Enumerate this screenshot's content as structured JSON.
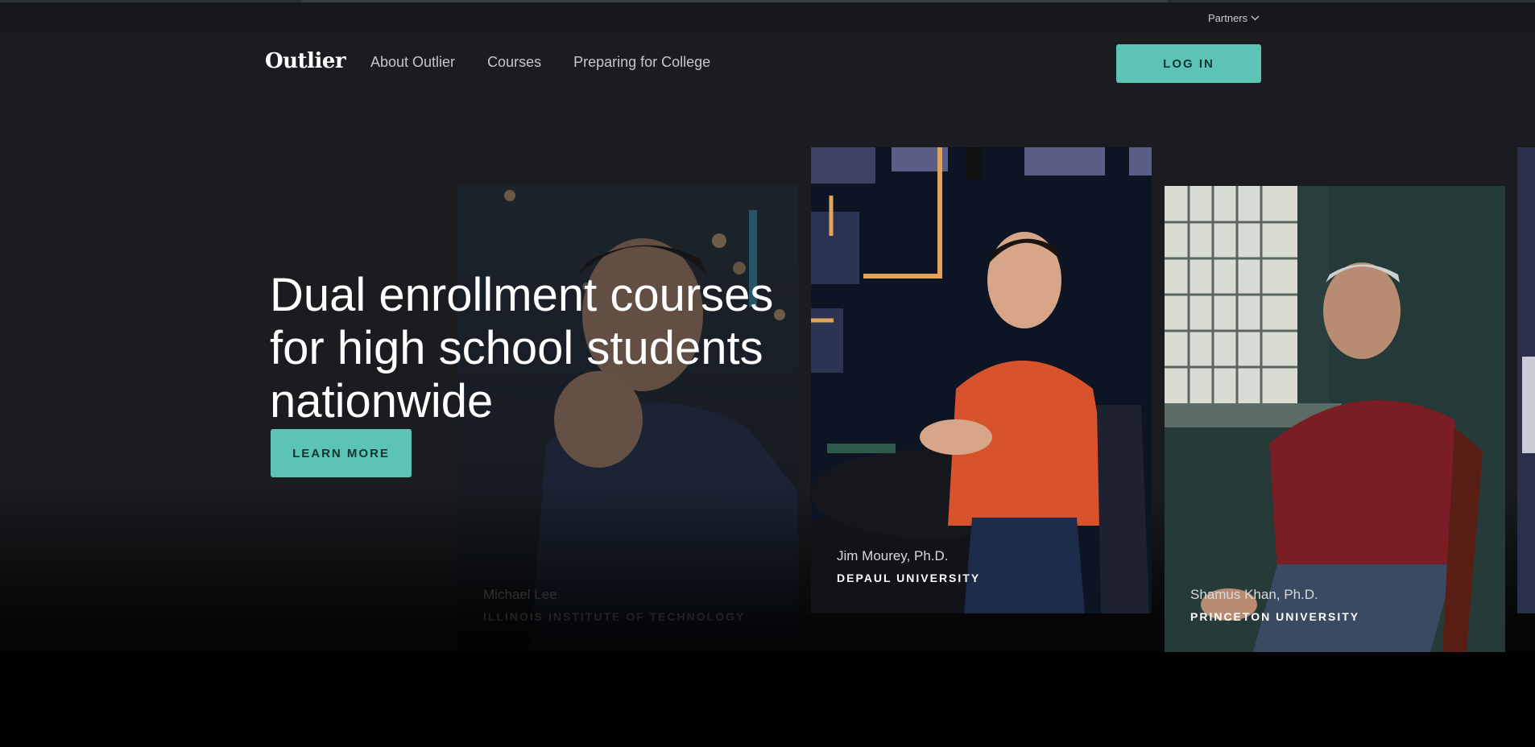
{
  "utility": {
    "partners_label": "Partners",
    "partners_icon": "chevron-down-icon"
  },
  "nav": {
    "logo": "Outlier",
    "links": [
      "About Outlier",
      "Courses",
      "Preparing for College"
    ],
    "login_label": "LOG IN"
  },
  "hero": {
    "title": "Dual enrollment courses for high school students nationwide",
    "cta_label": "LEARN MORE"
  },
  "instructors": [
    {
      "name": "Michael Lee",
      "school": "ILLINOIS INSTITUTE OF TECHNOLOGY"
    },
    {
      "name": "Jim Mourey, Ph.D.",
      "school": "DEPAUL UNIVERSITY"
    },
    {
      "name": "Shamus Khan, Ph.D.",
      "school": "PRINCETON UNIVERSITY"
    }
  ],
  "colors": {
    "accent": "#5bc4b4",
    "background": "#1b1c20",
    "utility_bar": "#17181b"
  }
}
